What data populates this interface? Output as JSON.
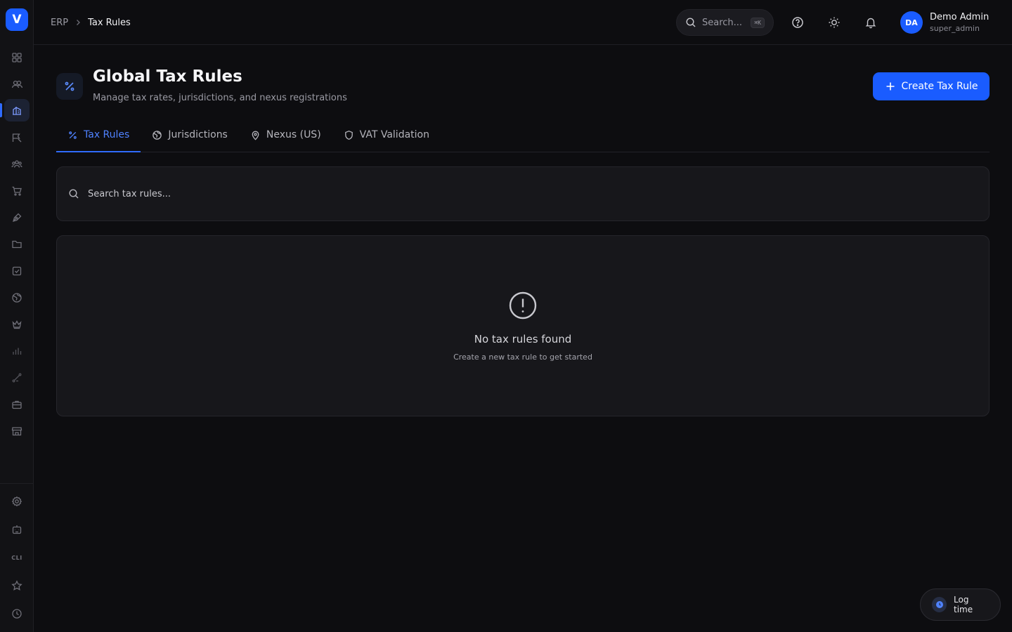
{
  "sidebar": {
    "logo_letter": "V",
    "bottom": {
      "cli_label": "CLI"
    }
  },
  "breadcrumb": {
    "root": "ERP",
    "current": "Tax Rules"
  },
  "topbar": {
    "search_placeholder": "Search...",
    "search_shortcut": "⌘K",
    "user": {
      "initials": "DA",
      "name": "Demo Admin",
      "role": "super_admin"
    }
  },
  "page": {
    "title": "Global Tax Rules",
    "subtitle": "Manage tax rates, jurisdictions, and nexus registrations",
    "create_button": "Create Tax Rule"
  },
  "tabs": [
    {
      "label": "Tax Rules",
      "icon": "percent-icon",
      "active": true
    },
    {
      "label": "Jurisdictions",
      "icon": "globe-icon",
      "active": false
    },
    {
      "label": "Nexus (US)",
      "icon": "map-pin-icon",
      "active": false
    },
    {
      "label": "VAT Validation",
      "icon": "shield-icon",
      "active": false
    }
  ],
  "search": {
    "placeholder": "Search tax rules..."
  },
  "empty_state": {
    "title": "No tax rules found",
    "subtitle": "Create a new tax rule to get started"
  },
  "log_time": {
    "label": "Log time"
  },
  "colors": {
    "accent": "#1a5cff",
    "background": "#0d0d10",
    "card": "#17171b"
  }
}
